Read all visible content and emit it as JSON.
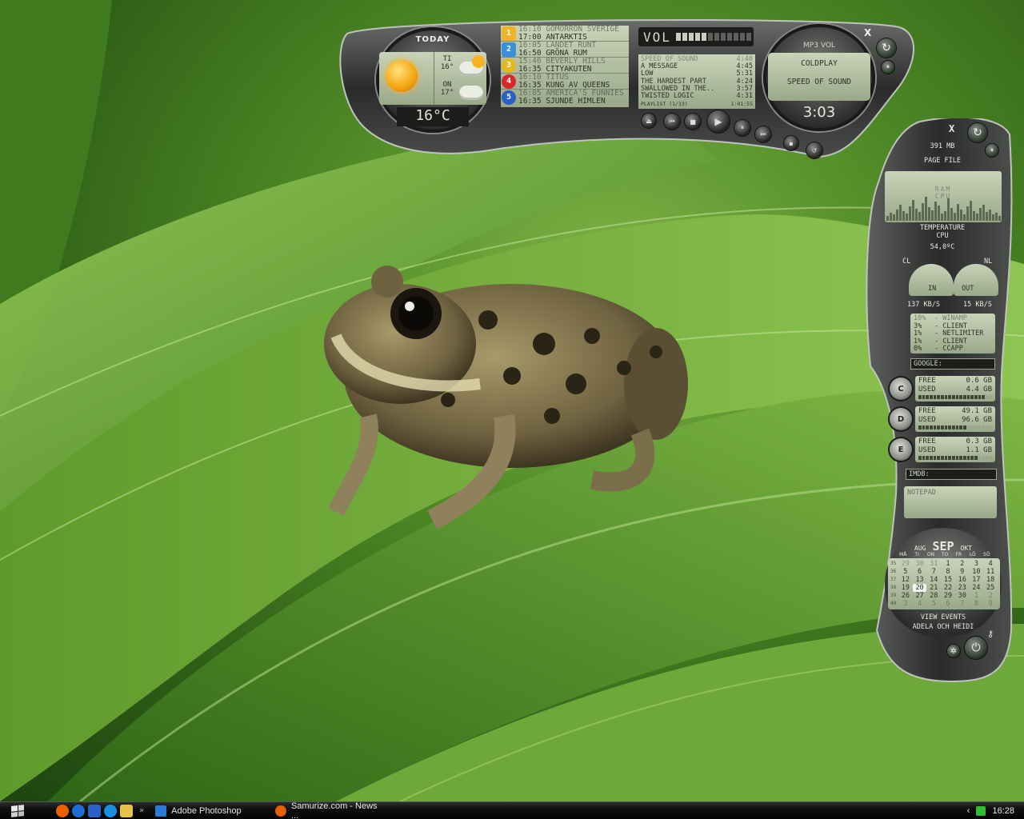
{
  "colors": {
    "lcd": "#b7c3a5",
    "metal": "#3a3b3a",
    "taskbar": "#0f0f0f",
    "wallpaper_green": "#4f8a26"
  },
  "weather": {
    "title": "TODAY",
    "current_temp": "16°C",
    "forecast": [
      {
        "day": "TI",
        "temp": "16°",
        "icon": "sun-cloud-icon"
      },
      {
        "day": "ON",
        "temp": "17°",
        "icon": "cloud-icon"
      }
    ],
    "icon": "sun-icon"
  },
  "tv_guide": [
    {
      "channel": "1",
      "color": "#f0b429",
      "now": "16:10 GOMORRON SVERIGE",
      "next": "17:00 ANTARKTIS"
    },
    {
      "channel": "2",
      "color": "#3a8fd9",
      "now": "16:05 LANDET RUNT",
      "next": "16:50 GRÖNA RUM"
    },
    {
      "channel": "3",
      "color": "#e3b81a",
      "now": "15:40 BEVERLY HILLS",
      "next": "16:35 CITYAKUTEN"
    },
    {
      "channel": "4",
      "color": "#d6282b",
      "now": "16:10 TITUS",
      "next": "16:35 KUNG AV QUEENS"
    },
    {
      "channel": "5",
      "color": "#2a5fc4",
      "now": "16:05 AMERICA'S FUNNIES",
      "next": "16:35 SJUNDE HIMLEN"
    }
  ],
  "player": {
    "vol_label": "VOL",
    "vol_level": 0.45,
    "playlist": [
      {
        "title": "SPEED OF SOUND",
        "time": "4:48",
        "dim": true
      },
      {
        "title": "A MESSAGE",
        "time": "4:45",
        "dim": false
      },
      {
        "title": "LOW",
        "time": "5:31",
        "dim": false
      },
      {
        "title": "THE HARDEST PART",
        "time": "4:24",
        "dim": false
      },
      {
        "title": "SWALLOWED IN THE..",
        "time": "3:57",
        "dim": false
      },
      {
        "title": "TWISTED LOGIC",
        "time": "4:31",
        "dim": false
      }
    ],
    "playlist_label": "PLAYLIST",
    "playlist_pos": "(1/13)",
    "playlist_total": "1:01:55",
    "mode": "MP3 VOL",
    "artist": "COLDPLAY",
    "track": "SPEED OF SOUND",
    "time": "3:03",
    "controls": [
      {
        "name": "eject-icon",
        "glyph": "⏏"
      },
      {
        "name": "previous-icon",
        "glyph": "⏮"
      },
      {
        "name": "stop-icon",
        "glyph": "■"
      },
      {
        "name": "play-icon",
        "glyph": "▶"
      },
      {
        "name": "pause-icon",
        "glyph": "⏸"
      },
      {
        "name": "next-icon",
        "glyph": "⏭"
      },
      {
        "name": "volume-icon",
        "glyph": "▪"
      },
      {
        "name": "repeat-icon",
        "glyph": "↺"
      }
    ],
    "close": "X",
    "refresh_icon": "↻",
    "pause_icon": "⏸"
  },
  "sysmon": {
    "close": "X",
    "page_file_value": "391 MB",
    "page_file_label": "PAGE FILE",
    "graph_labels": [
      "RAM",
      "CPU"
    ],
    "temp_label": "TEMPERATURE",
    "cpu_label": "CPU",
    "cpu_temp": "54,0ºC",
    "cl_label": "CL",
    "nl_label": "NL",
    "net_in_label": "IN",
    "net_out_label": "OUT",
    "net_in": "137 KB/S",
    "net_out": "15 KB/S",
    "processes": [
      {
        "pct": "10%",
        "name": "- WINAMP",
        "dim": true
      },
      {
        "pct": "3%",
        "name": "- CLIENT",
        "dim": false
      },
      {
        "pct": "1%",
        "name": "- NETLIMITER",
        "dim": false
      },
      {
        "pct": "1%",
        "name": "- CLIENT",
        "dim": false
      },
      {
        "pct": "0%",
        "name": "- CCAPP",
        "dim": false
      }
    ],
    "google_label": "GOOGLE:",
    "imdb_label": "IMDB:",
    "drives": [
      {
        "letter": "C",
        "free_label": "FREE",
        "free": "0.6 GB",
        "used_label": "USED",
        "used": "4.4 GB",
        "fill": 0.88
      },
      {
        "letter": "D",
        "free_label": "FREE",
        "free": "49.1 GB",
        "used_label": "USED",
        "used": "96.6 GB",
        "fill": 0.66
      },
      {
        "letter": "E",
        "free_label": "FREE",
        "free": "0.3 GB",
        "used_label": "USED",
        "used": "1.1 GB",
        "fill": 0.78
      }
    ],
    "notepad_label": "NOTEPAD"
  },
  "calendar": {
    "prev": "AUG",
    "month": "SEP",
    "next": "OKT",
    "days": [
      "MÅ",
      "TI",
      "ON",
      "TO",
      "FR",
      "LÖ",
      "SÖ"
    ],
    "weeks": [
      {
        "wk": "35",
        "d": [
          "29",
          "30",
          "31",
          "1",
          "2",
          "3",
          "4"
        ],
        "dim": [
          true,
          true,
          true,
          false,
          false,
          false,
          false
        ]
      },
      {
        "wk": "36",
        "d": [
          "5",
          "6",
          "7",
          "8",
          "9",
          "10",
          "11"
        ],
        "dim": [
          false,
          false,
          false,
          false,
          false,
          false,
          false
        ]
      },
      {
        "wk": "37",
        "d": [
          "12",
          "13",
          "14",
          "15",
          "16",
          "17",
          "18"
        ],
        "dim": [
          false,
          false,
          false,
          false,
          false,
          false,
          false
        ]
      },
      {
        "wk": "38",
        "d": [
          "19",
          "20",
          "21",
          "22",
          "23",
          "24",
          "25"
        ],
        "dim": [
          false,
          false,
          false,
          false,
          false,
          false,
          false
        ]
      },
      {
        "wk": "39",
        "d": [
          "26",
          "27",
          "28",
          "29",
          "30",
          "1",
          "2"
        ],
        "dim": [
          false,
          false,
          false,
          false,
          false,
          true,
          true
        ]
      },
      {
        "wk": "40",
        "d": [
          "3",
          "4",
          "5",
          "6",
          "7",
          "8",
          "9"
        ],
        "dim": [
          true,
          true,
          true,
          true,
          true,
          true,
          true
        ]
      }
    ],
    "today": "20",
    "view_events": "VIEW EVENTS",
    "event": "ADELA OCH HEIDI"
  },
  "taskbar": {
    "quicklaunch": [
      {
        "name": "firefox-icon",
        "color": "#e66000"
      },
      {
        "name": "ie-icon",
        "color": "#1f6fd0"
      },
      {
        "name": "outlook-icon",
        "color": "#2b62c9"
      },
      {
        "name": "ie-alt-icon",
        "color": "#1a8fe0"
      },
      {
        "name": "folder-icon",
        "color": "#e7c04a"
      }
    ],
    "chevron": "»",
    "tasks": [
      {
        "label": "Adobe Photoshop",
        "icon": "photoshop-icon",
        "color": "#2c7bd6"
      },
      {
        "label": "Samurize.com - News ...",
        "icon": "firefox-icon",
        "color": "#e66000"
      }
    ],
    "tray_arrow": "‹",
    "clock": "16:28"
  }
}
